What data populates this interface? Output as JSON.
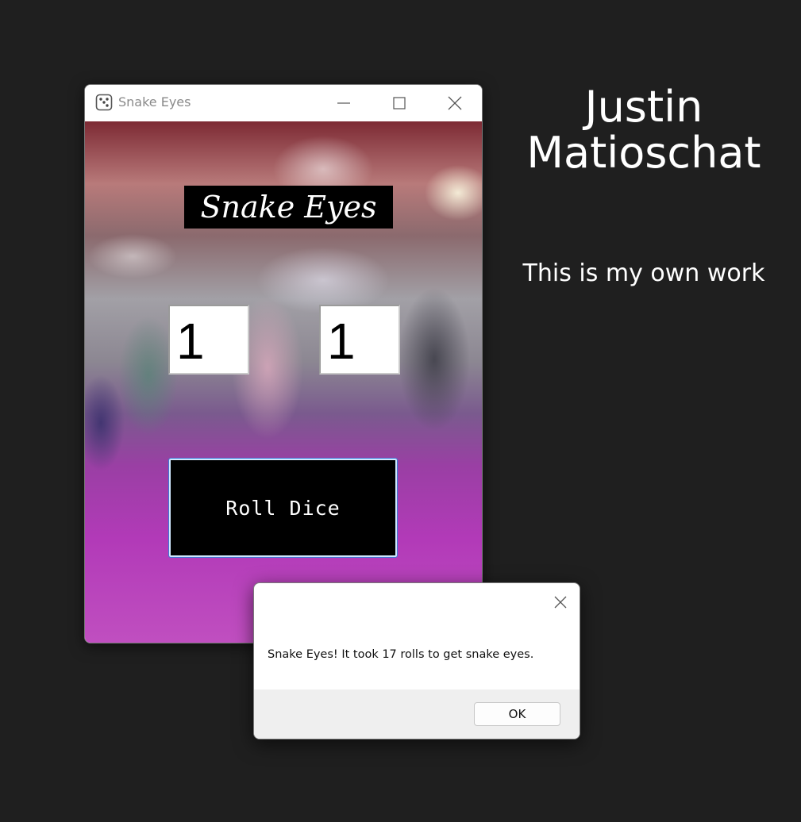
{
  "window": {
    "title": "Snake Eyes",
    "icon": "dice-icon"
  },
  "app": {
    "banner": "Snake Eyes",
    "dice": [
      "1",
      "1"
    ],
    "roll_button_label": "Roll Dice"
  },
  "dialog": {
    "message": "Snake Eyes! It took 17 rolls to get snake eyes.",
    "ok_label": "OK"
  },
  "side": {
    "author_first": "Justin",
    "author_last": "Matioschat",
    "note": "This is my own work"
  },
  "colors": {
    "desktop_background": "#1f1f1f",
    "button_background": "#000000",
    "button_text": "#ffffff",
    "side_text": "#ffffff"
  }
}
